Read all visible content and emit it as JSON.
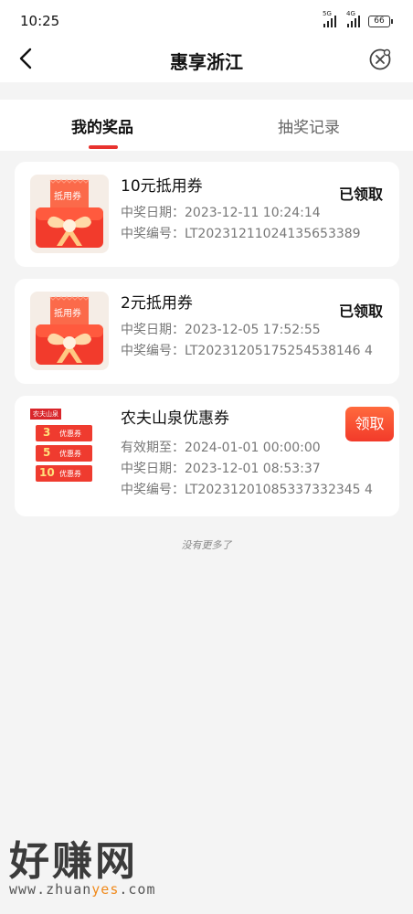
{
  "status_bar": {
    "time": "10:25",
    "battery": "66",
    "net1": "5G",
    "net2": "4G"
  },
  "header": {
    "title": "惠享浙江"
  },
  "tabs": [
    {
      "label": "我的奖品",
      "active": true
    },
    {
      "label": "抽奖记录",
      "active": false
    }
  ],
  "prizes": [
    {
      "title": "10元抵用券",
      "thumb_text": "抵用券",
      "date_label": "中奖日期：",
      "date_value": "2023-12-11 10:24:14",
      "no_label": "中奖编号：",
      "no_value": "LT20231211024135653389",
      "status": "已领取"
    },
    {
      "title": "2元抵用券",
      "thumb_text": "抵用券",
      "date_label": "中奖日期：",
      "date_value": "2023-12-05 17:52:55",
      "no_label": "中奖编号：",
      "no_value": "LT20231205175254538146 4",
      "status": "已领取"
    },
    {
      "title": "农夫山泉优惠券",
      "thumb_brand": "农夫山泉",
      "coupon_values": [
        "3",
        "5",
        "10"
      ],
      "coupon_tag": "优惠券",
      "valid_label": "有效期至：",
      "valid_value": "2024-01-01 00:00:00",
      "date_label": "中奖日期：",
      "date_value": "2023-12-01 08:53:37",
      "no_label": "中奖编号：",
      "no_value": "LT20231201085337332345 4",
      "action": "领取"
    }
  ],
  "footer_note": "没有更多了",
  "watermark": {
    "cn": "好赚网",
    "url_pre": "www.zhuan",
    "url_hl": "yes",
    "url_post": ".com"
  },
  "colors": {
    "accent": "#e8322e",
    "claim_button": "#f23a2a"
  }
}
